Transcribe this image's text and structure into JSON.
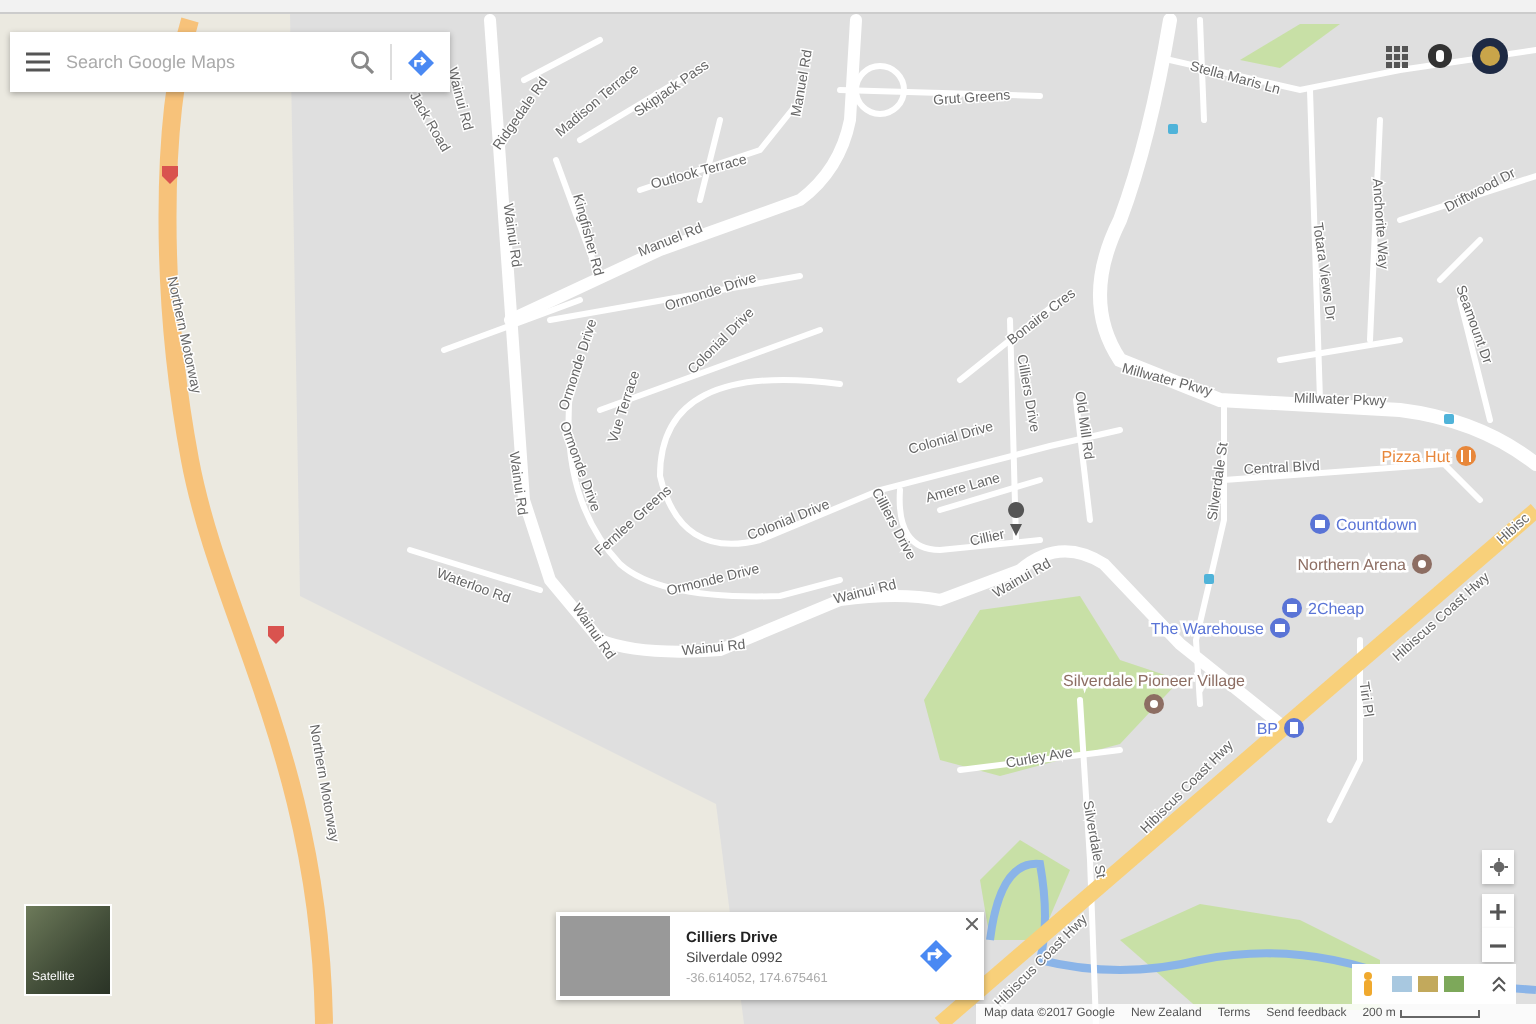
{
  "search": {
    "placeholder": "Search Google Maps"
  },
  "street_labels": [
    "Northern Motorway",
    "Northern Motorway",
    "Ridgedale Rd",
    "Madison Terrace",
    "Skipjack Pass",
    "Outlook Terrace",
    "Kingfisher Rd",
    "Wainui Rd",
    "Manuel Rd",
    "Manuel Rd",
    "Ormonde Drive",
    "Grut Greens",
    "Stella Maris Ln",
    "Totara Views Dr",
    "Anchorite Way",
    "Driftwood Dr",
    "Seamount Dr",
    "Bonaire Cres",
    "Cilliers Drive",
    "Old Mill Rd",
    "Millwater Pkwy",
    "Millwater Pkwy",
    "Ormonde Drive",
    "Colonial Drive",
    "Vue Terrace",
    "Ormonde Drive",
    "Wainui Rd",
    "Colonial Drive",
    "Amere Lane",
    "Cilliers Drive",
    "Cillier",
    "Colonial Drive",
    "Fernlee Greens",
    "Ormonde Drive",
    "Waterloo Rd",
    "Wainui Rd",
    "Wainui Rd",
    "Wainui Rd",
    "Wainui Rd",
    "Central Blvd",
    "Silverdale St",
    "Hibiscus Coast Hwy",
    "Hibisc",
    "Curley Ave",
    "Silverdale St",
    "Hibiscus Coast Hwy",
    "Hibiscus Coast Hwy",
    "Tiri Pl",
    "Jack Road",
    "Wainui Rd"
  ],
  "places": [
    {
      "name": "Pizza Hut",
      "kind": "restaurant",
      "color": "#e8873a"
    },
    {
      "name": "Countdown",
      "kind": "shop",
      "color": "#5a74d6"
    },
    {
      "name": "Northern Arena",
      "kind": "venue",
      "color": "#8d6e63"
    },
    {
      "name": "2Cheap",
      "kind": "shop",
      "color": "#5a74d6"
    },
    {
      "name": "The Warehouse",
      "kind": "shop",
      "color": "#5a74d6"
    },
    {
      "name": "Silverdale Pioneer Village",
      "kind": "museum",
      "color": "#8d6e63"
    },
    {
      "name": "BP",
      "kind": "fuel",
      "color": "#5a74d6"
    }
  ],
  "info_card": {
    "title": "Cilliers Drive",
    "subtitle": "Silverdale 0992",
    "coordinates": "-36.614052, 174.675461"
  },
  "layer_toggle": {
    "label": "Satellite"
  },
  "footer": [
    "Map data ©2017 Google",
    "New Zealand",
    "Terms",
    "Send feedback",
    "200 m"
  ]
}
